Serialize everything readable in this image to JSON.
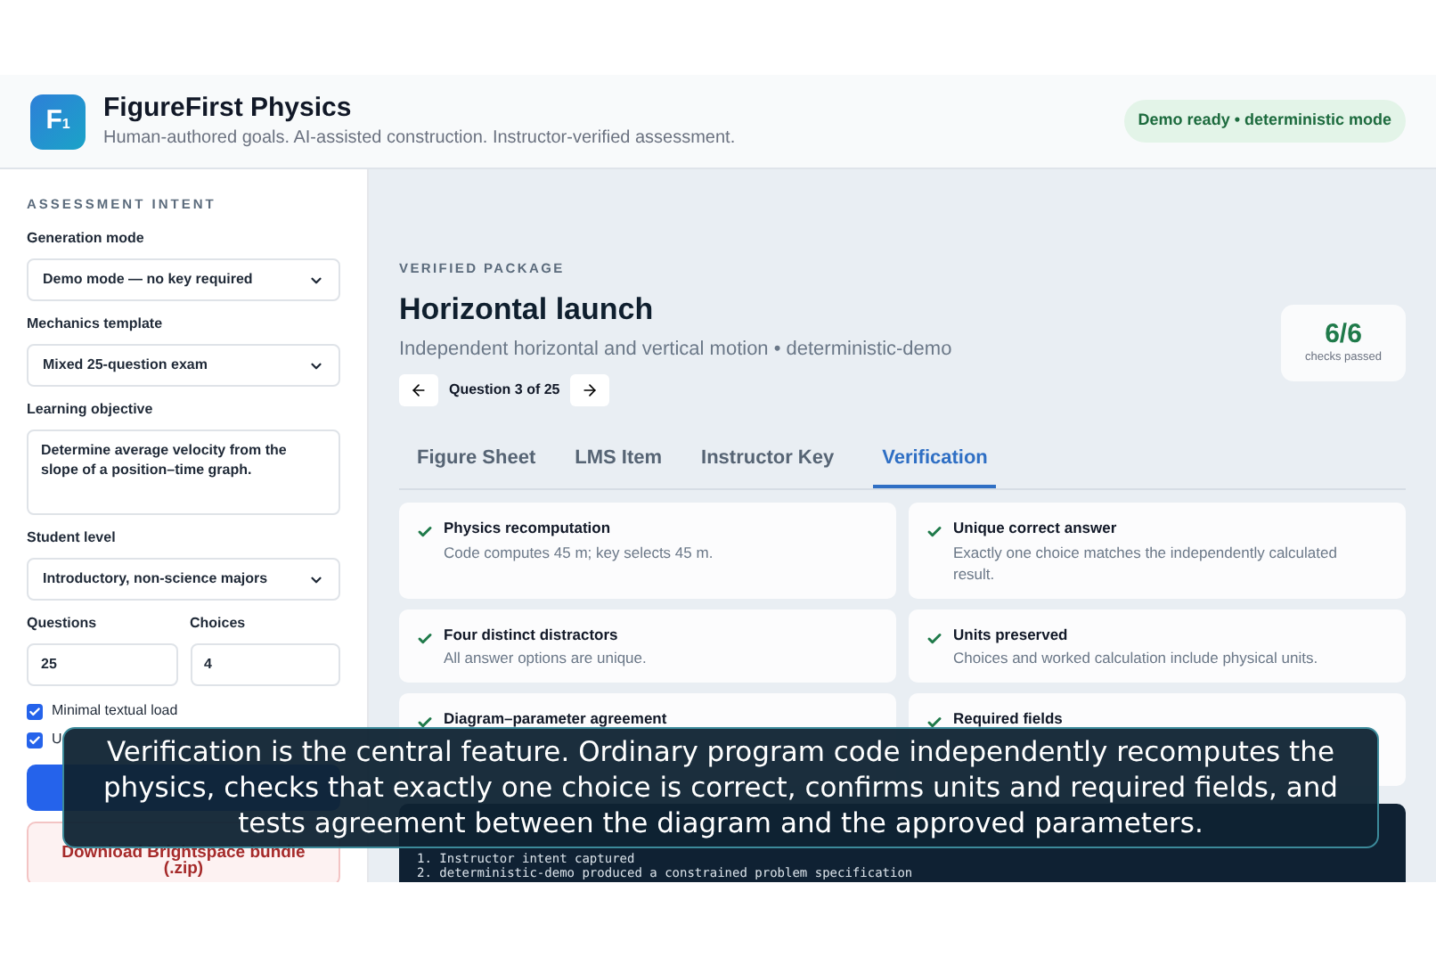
{
  "header": {
    "logo": "F",
    "logo_sub": "1",
    "title": "FigureFirst Physics",
    "subtitle": "Human-authored goals. AI-assisted construction. Instructor-verified assessment.",
    "status": "Demo ready • deterministic mode"
  },
  "sidebar": {
    "heading": "ASSESSMENT INTENT",
    "fields": [
      {
        "kind": "select",
        "label": "Generation mode",
        "value": "Demo mode — no key required"
      },
      {
        "kind": "select",
        "label": "Mechanics template",
        "value": "Mixed 25-question exam"
      },
      {
        "kind": "textarea",
        "label": "Learning objective",
        "value": "Determine average velocity from the slope of a position–time graph."
      },
      {
        "kind": "select",
        "label": "Student level",
        "value": "Introductory, non-science majors"
      }
    ],
    "numbers": [
      {
        "label": "Questions",
        "value": "25"
      },
      {
        "label": "Choices",
        "value": "4"
      }
    ],
    "checkboxes": [
      {
        "label": "Minimal textual load",
        "checked": true
      },
      {
        "label": "U",
        "checked": true
      }
    ],
    "download": "Download Brightspace bundle (.zip)"
  },
  "main": {
    "eyebrow": "VERIFIED PACKAGE",
    "title": "Horizontal launch",
    "subtitle": "Independent horizontal and vertical motion • deterministic-demo",
    "pager": "Question 3 of 25",
    "score": "6/6",
    "score_label": "checks passed",
    "tabs": [
      {
        "label": "Figure Sheet",
        "selected": false
      },
      {
        "label": "LMS Item",
        "selected": false
      },
      {
        "label": "Instructor Key",
        "selected": false
      },
      {
        "label": "Verification",
        "selected": true
      }
    ],
    "checks": [
      {
        "title": "Physics recomputation",
        "detail": "Code computes 45 m; key selects 45 m.",
        "passed": true
      },
      {
        "title": "Unique correct answer",
        "detail": "Exactly one choice matches the independently calculated result.",
        "passed": true
      },
      {
        "title": "Four distinct distractors",
        "detail": "All answer options are unique.",
        "passed": true
      },
      {
        "title": "Units preserved",
        "detail": "Choices and worked calculation include physical units.",
        "passed": true
      },
      {
        "title": "Diagram–parameter agreement",
        "passed": true
      },
      {
        "title": "Required fields",
        "passed": true
      }
    ],
    "log": [
      "1. Instructor intent captured",
      "2. deterministic-demo produced a constrained problem specification"
    ]
  },
  "caption": "Verification is the central feature. Ordinary program code independently recomputes the physics, checks that exactly one choice is correct, confirms units and required fields, and tests agreement between the diagram and the approved parameters."
}
